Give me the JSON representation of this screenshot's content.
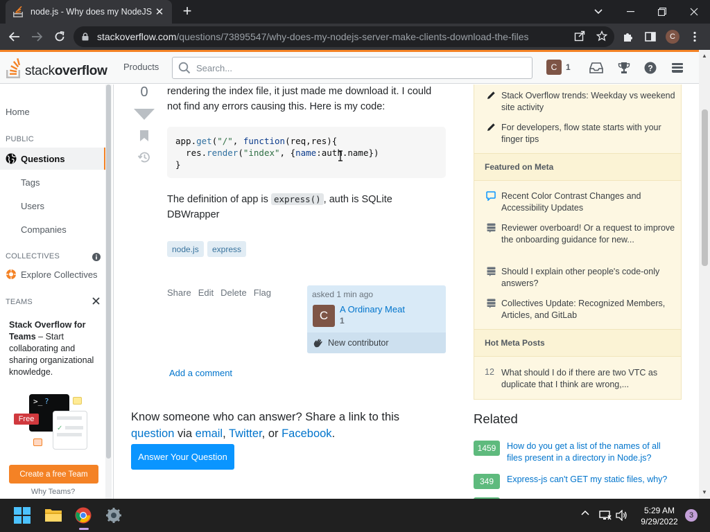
{
  "browser": {
    "tab_title": "node.js - Why does my NodeJS S",
    "url_host": "stackoverflow.com",
    "url_path": "/questions/73895547/why-does-my-nodejs-server-make-clients-download-the-files",
    "profile_initial": "C"
  },
  "header": {
    "logo_light": "stack",
    "logo_bold": "overflow",
    "products": "Products",
    "search_placeholder": "Search...",
    "user_initial": "C",
    "reputation": "1"
  },
  "leftnav": {
    "home": "Home",
    "public_head": "PUBLIC",
    "questions": "Questions",
    "tags": "Tags",
    "users": "Users",
    "companies": "Companies",
    "collectives_head": "COLLECTIVES",
    "explore_collectives": "Explore Collectives",
    "teams_head": "TEAMS",
    "teams_title": "Stack Overflow for Teams",
    "teams_body": " – Start collaborating and sharing organizational knowledge.",
    "free_badge": "Free",
    "create_team": "Create a free Team",
    "why_teams": "Why Teams?"
  },
  "question": {
    "votes": "0",
    "text_line1": "rendering the index file, it just made me download it. I could",
    "text_line2": "not find any errors causing this. Here is my code:",
    "code": {
      "l1_a": "app.",
      "l1_fn": "get",
      "l1_b": "(",
      "l1_str": "\"/\"",
      "l1_c": ", ",
      "l1_kw": "function",
      "l1_d": "(req,res){",
      "l2_a": "  res.",
      "l2_fn": "render",
      "l2_b": "(",
      "l2_str": "\"index\"",
      "l2_c": ", {",
      "l2_kw": "name",
      "l2_d": ":auth.name})",
      "l3": "}"
    },
    "def_a": "The definition of app is ",
    "def_code": "express()",
    "def_b": ", auth is SQLite",
    "def_c": "DBWrapper",
    "tags": [
      "node.js",
      "express"
    ],
    "menu": [
      "Share",
      "Edit",
      "Delete",
      "Flag"
    ],
    "asked": "asked 1 min ago",
    "author_initial": "C",
    "author": "A Ordinary Meat",
    "author_rep": "1",
    "new_contributor": "New contributor",
    "add_comment": "Add a comment",
    "know_a": "Know someone who can answer? Share a link to this ",
    "know_question": "question",
    "know_via": " via ",
    "know_email": "email",
    "know_comma": ", ",
    "know_twitter": "Twitter",
    "know_or": ", or ",
    "know_facebook": "Facebook",
    "know_end": ".",
    "answer_button": "Answer Your Question"
  },
  "sidebar": {
    "blog_items": [
      "Stack Overflow trends: Weekday vs weekend site activity",
      "For developers, flow state starts with your finger tips"
    ],
    "meta_head": "Featured on Meta",
    "meta_items": [
      "Recent Color Contrast Changes and Accessibility Updates",
      "Reviewer overboard! Or a request to improve the onboarding guidance for new...",
      "Should I explain other people's code-only answers?",
      "Collectives Update: Recognized Members, Articles, and GitLab"
    ],
    "hot_head": "Hot Meta Posts",
    "hot_count": "12",
    "hot_item": "What should I do if there are two VTC as duplicate that I think are wrong,...",
    "related_title": "Related",
    "related": [
      {
        "score": "1459",
        "title": "How do you get a list of the names of all files present in a directory in Node.js?"
      },
      {
        "score": "349",
        "title": "Express-js can't GET my static files, why?"
      }
    ]
  },
  "taskbar": {
    "time": "5:29 AM",
    "date": "9/29/2022",
    "notifications": "3"
  },
  "colors": {
    "so_orange": "#f48225",
    "so_blue": "#0a95ff",
    "link_blue": "#0074cc",
    "yellow_box": "#fdf7e2",
    "accepted_green": "#5eba7d"
  }
}
